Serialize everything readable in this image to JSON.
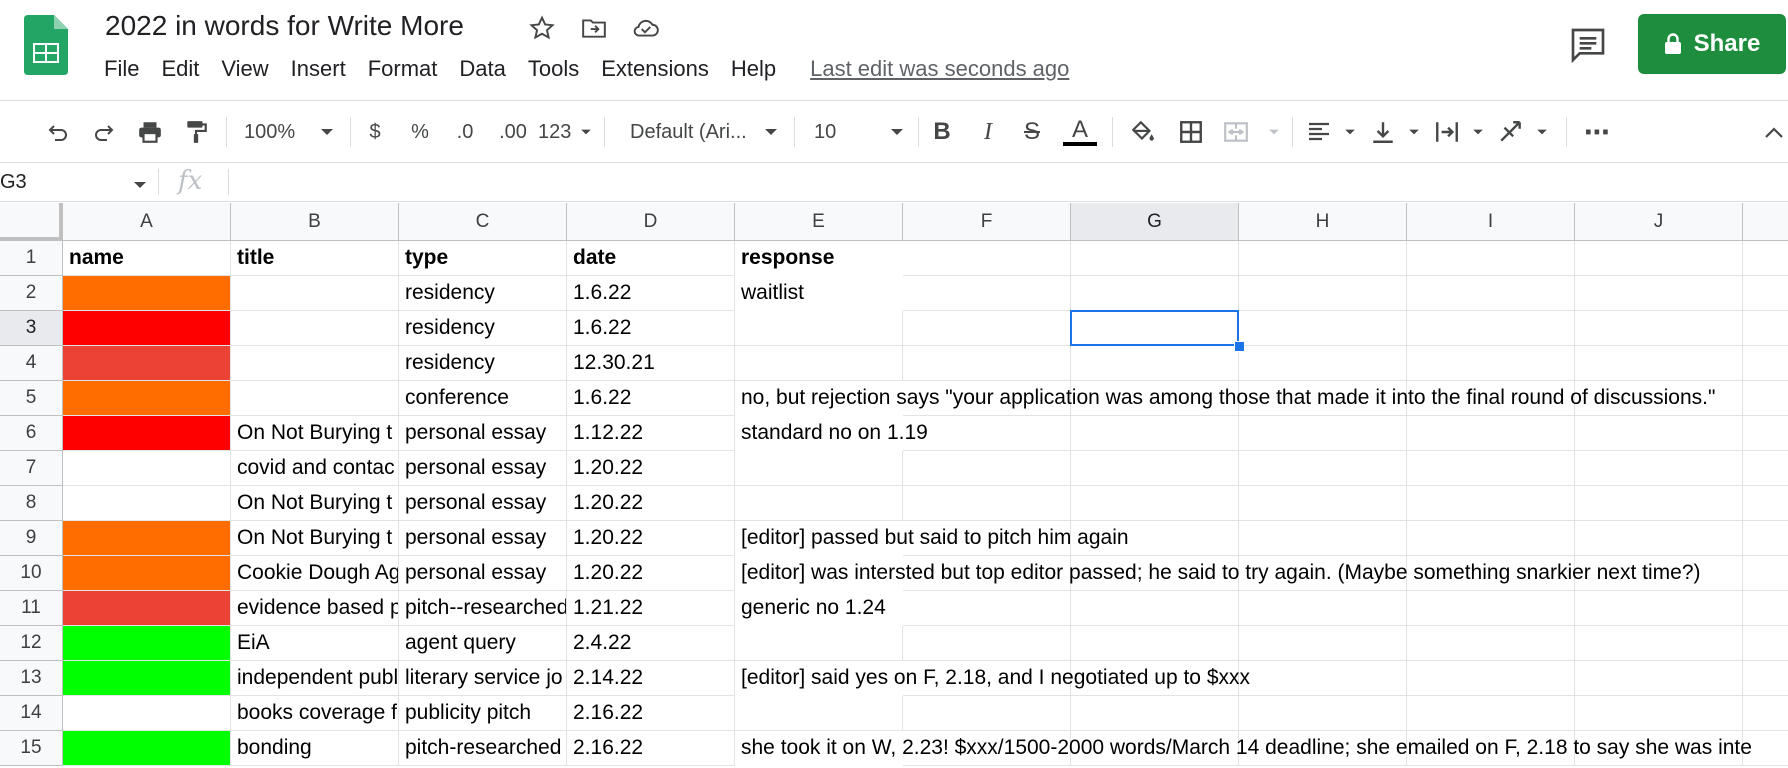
{
  "doc": {
    "title": "2022 in words for Write More",
    "last_edit": "Last edit was seconds ago"
  },
  "menu": [
    "File",
    "Edit",
    "View",
    "Insert",
    "Format",
    "Data",
    "Tools",
    "Extensions",
    "Help"
  ],
  "share_label": "Share",
  "toolbar": {
    "zoom": "100%",
    "currency": "$",
    "percent": "%",
    "dec_decrease": ".0",
    "dec_increase": ".00",
    "number_format": "123",
    "font": "Default (Ari...",
    "font_size": "10",
    "bold": "B",
    "italic": "I",
    "strike": "S",
    "text_color": "A",
    "more": "⋯"
  },
  "formula_bar": {
    "name_box": "G3",
    "fx": "fx",
    "value": ""
  },
  "selected_cell": "G3",
  "columns": [
    "A",
    "B",
    "C",
    "D",
    "E",
    "F",
    "G",
    "H",
    "I",
    "J"
  ],
  "rows": [
    {
      "num": "1",
      "a_fill": "",
      "b": "title",
      "c": "type",
      "d": "date",
      "e": "response",
      "a": "name",
      "header": true
    },
    {
      "num": "2",
      "a_fill": "#ff6d01",
      "b": "",
      "c": "residency",
      "d": "1.6.22",
      "e": "waitlist"
    },
    {
      "num": "3",
      "a_fill": "#ff0000",
      "b": "",
      "c": "residency",
      "d": "1.6.22",
      "e": ""
    },
    {
      "num": "4",
      "a_fill": "#ea4335",
      "b": "",
      "c": "residency",
      "d": "12.30.21",
      "e": ""
    },
    {
      "num": "5",
      "a_fill": "#ff6d01",
      "b": "",
      "c": "conference",
      "d": "1.6.22",
      "e": "no, but rejection says \"your application was among those that made it into the final round of discussions.\""
    },
    {
      "num": "6",
      "a_fill": "#ff0000",
      "b": "On Not Burying t",
      "c": "personal essay",
      "d": "1.12.22",
      "e": "standard no on 1.19"
    },
    {
      "num": "7",
      "a_fill": "",
      "b": "covid and contac",
      "c": "personal essay",
      "d": "1.20.22",
      "e": ""
    },
    {
      "num": "8",
      "a_fill": "",
      "b": "On Not Burying t",
      "c": "personal essay",
      "d": "1.20.22",
      "e": ""
    },
    {
      "num": "9",
      "a_fill": "#ff6d01",
      "b": "On Not Burying t",
      "c": "personal essay",
      "d": "1.20.22",
      "e": "[editor] passed but said to pitch him again"
    },
    {
      "num": "10",
      "a_fill": "#ff6d01",
      "b": "Cookie Dough Ag",
      "c": "personal essay",
      "d": "1.20.22",
      "e": "[editor] was intersted but top editor passed; he said to try again. (Maybe something snarkier next time?)"
    },
    {
      "num": "11",
      "a_fill": "#ea4335",
      "b": "evidence based p",
      "c": "pitch--researched",
      "d": "1.21.22",
      "e": "generic no 1.24"
    },
    {
      "num": "12",
      "a_fill": "#00ff00",
      "b": "EiA",
      "c": "agent query",
      "d": "2.4.22",
      "e": ""
    },
    {
      "num": "13",
      "a_fill": "#00ff00",
      "b": "independent publ",
      "c": "literary service jo",
      "d": "2.14.22",
      "e": "[editor] said yes on F, 2.18, and I negotiated up to $xxx"
    },
    {
      "num": "14",
      "a_fill": "",
      "b": "books coverage f",
      "c": "publicity pitch",
      "d": "2.16.22",
      "e": ""
    },
    {
      "num": "15",
      "a_fill": "#00ff00",
      "b": "bonding",
      "c": "pitch-researched",
      "d": "2.16.22",
      "e": "she took it on W, 2.23! $xxx/1500-2000 words/March 14 deadline; she emailed on F, 2.18 to say she was inte"
    }
  ],
  "colors": {
    "share": "#1e8e3e",
    "selection": "#1a73e8",
    "logo": "#23a566"
  }
}
